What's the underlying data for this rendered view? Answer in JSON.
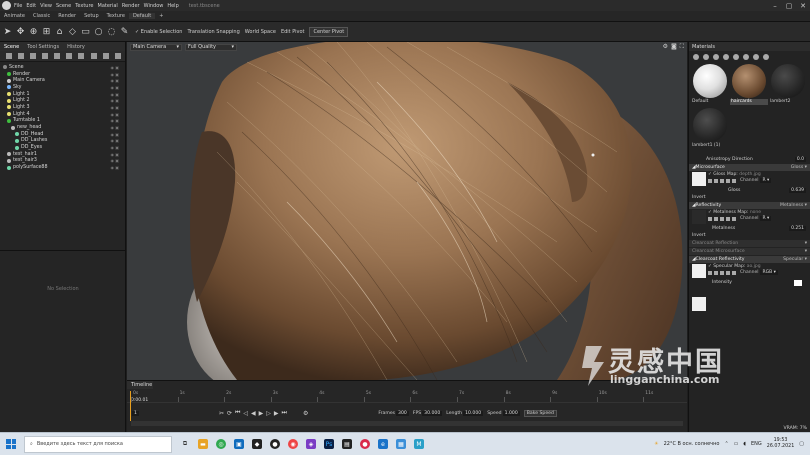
{
  "titlebar": {
    "menu": [
      "File",
      "Edit",
      "View",
      "Scene",
      "Texture",
      "Material",
      "Render",
      "Window",
      "Help"
    ],
    "file_title": "test.tbscene"
  },
  "tabs": [
    "Animate",
    "Classic",
    "Render",
    "Setup",
    "Texture",
    "Default",
    "+"
  ],
  "toolbar": {
    "enable_selection": "Enable Selection",
    "translation_snapping": "Translation Snapping",
    "world_space": "World Space",
    "edit_pivot": "Edit Pivot",
    "center_pivot": "Center Pivot"
  },
  "left_panel": {
    "tabs": [
      "Scene",
      "Tool Settings",
      "History"
    ],
    "tree": [
      {
        "label": "Scene",
        "indent": 0,
        "color": "#888888"
      },
      {
        "label": "Render",
        "indent": 1,
        "color": "#3fbf3f"
      },
      {
        "label": "Main Camera",
        "indent": 1,
        "color": "#cccccc"
      },
      {
        "label": "Sky",
        "indent": 1,
        "color": "#7ab8ff"
      },
      {
        "label": "Light 1",
        "indent": 1,
        "color": "#e8e070"
      },
      {
        "label": "Light 2",
        "indent": 1,
        "color": "#e8e070"
      },
      {
        "label": "Light 3",
        "indent": 1,
        "color": "#e8e070"
      },
      {
        "label": "Light 4",
        "indent": 1,
        "color": "#e8e070"
      },
      {
        "label": "Turntable 1",
        "indent": 1,
        "color": "#3fbf3f"
      },
      {
        "label": "new_head",
        "indent": 2,
        "color": "#bbbbbb"
      },
      {
        "label": "DD_Head",
        "indent": 3,
        "color": "#6fd6a8"
      },
      {
        "label": "DD_Lashes",
        "indent": 3,
        "color": "#6fd6a8"
      },
      {
        "label": "DD_Eyes",
        "indent": 3,
        "color": "#6fd6a8"
      },
      {
        "label": "test_hair1",
        "indent": 1,
        "color": "#bbbbbb"
      },
      {
        "label": "test_hair3",
        "indent": 1,
        "color": "#bbbbbb"
      },
      {
        "label": "polySurface88",
        "indent": 1,
        "color": "#6fd6a8"
      }
    ],
    "no_selection": "No Selection"
  },
  "viewport": {
    "camera": "Main Camera",
    "quality": "Full Quality"
  },
  "materials": {
    "header": "Materials",
    "items": [
      {
        "label": "Default",
        "swatch": "white"
      },
      {
        "label": "haircards",
        "swatch": "hair"
      },
      {
        "label": "lambert2",
        "swatch": "dark"
      },
      {
        "label": "lambert1 (1)",
        "swatch": "dark2"
      }
    ],
    "selected_index": 1
  },
  "props": {
    "anisotropy_label": "Anisotropy Direction",
    "anisotropy_value": "0.0",
    "microsurface": {
      "title": "Microsurface",
      "mode": "Gloss"
    },
    "gloss_map": "Gloss Map:",
    "gloss_file": "depth.jpg",
    "channel_label": "Channel",
    "channel_r": "R",
    "gloss_label": "Gloss",
    "gloss_value": "0.639",
    "invert": "Invert",
    "reflectivity": {
      "title": "Reflectivity",
      "mode": "Metalness"
    },
    "metalness_map": "Metalness Map:",
    "metalness_file": "none",
    "metalness_label": "Metalness",
    "metalness_value": "0.251",
    "invert2": "Invert",
    "clearcoat_reflection": "Clearcoat Reflection",
    "clearcoat_microsurface": "Clearcoat Microsurface",
    "clearcoat_reflectivity": {
      "title": "Clearcoat Reflectivity",
      "mode": "Specular"
    },
    "specular_map": "Specular Map:",
    "specular_file": "ao.jpg",
    "channel_rgb": "RGB",
    "intensity": "Intensity",
    "vram": "VRAM: 7%"
  },
  "timeline": {
    "title": "Timeline",
    "ticks": [
      "0s",
      "1s",
      "2s",
      "3s",
      "4s",
      "5s",
      "6s",
      "7s",
      "8s",
      "9s",
      "10s",
      "11s"
    ],
    "frame": "0:00.01",
    "start_frame": "1",
    "frames_label": "Frames",
    "frames_value": "300",
    "fps_label": "FPS",
    "fps_value": "30.000",
    "length_label": "Length",
    "length_value": "10.000",
    "speed_label": "Speed",
    "speed_value": "1.000",
    "bake_speed": "Bake Speed"
  },
  "taskbar": {
    "search_placeholder": "Введите здесь текст для поиска",
    "weather": "22°C  В осн. солнечно",
    "lang": "ENG",
    "time": "19:53",
    "date": "26.07.2021"
  },
  "watermark": {
    "cn": "灵感中国",
    "url": "lingganchina.com"
  }
}
